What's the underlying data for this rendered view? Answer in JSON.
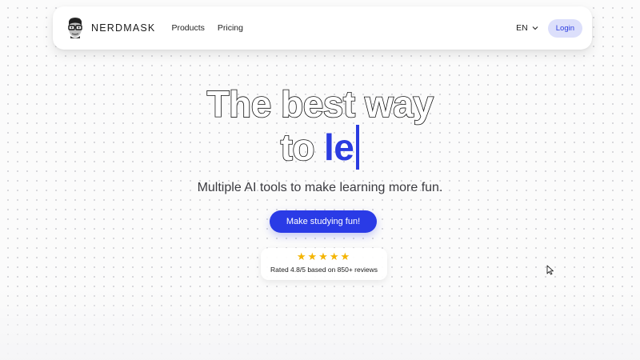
{
  "navbar": {
    "brand": "NERDMASK",
    "links": [
      "Products",
      "Pricing"
    ],
    "language": "EN",
    "login_label": "Login"
  },
  "hero": {
    "title_line1": "The best way",
    "title_line2_prefix": "to",
    "title_line2_typed": "le",
    "subtitle": "Multiple AI tools to make learning more fun.",
    "cta_label": "Make studying fun!",
    "stars": "★★★★★",
    "rating_text": "Rated 4.8/5 based on 850+ reviews"
  },
  "colors": {
    "accent": "#2b3ce0",
    "login_bg": "#dcdffb",
    "star": "#f4b400"
  },
  "icons": {
    "logo": "nerd-face-glasses-icon",
    "language_chevron": "chevron-down-icon",
    "mouse_cursor": "pointer-cursor-icon"
  }
}
